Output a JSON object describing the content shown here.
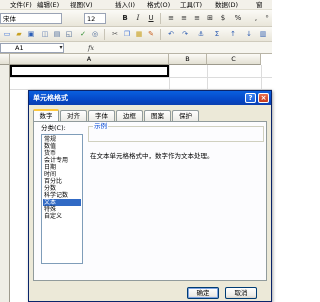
{
  "menubar": {
    "items": [
      "文件(F)",
      "编辑(E)",
      "视图(V)",
      "插入(I)",
      "格式(O)",
      "工具(T)",
      "数据(D)",
      "窗"
    ]
  },
  "toolbar": {
    "font_name": "宋体",
    "font_size": "12",
    "bold": "B",
    "italic": "I",
    "underline": "U",
    "percent": "%",
    "comma": ","
  },
  "formula_bar": {
    "cell_ref": "A1",
    "fx": "fx"
  },
  "sheet": {
    "columns": [
      "A",
      "B",
      "C"
    ]
  },
  "dialog": {
    "title": "单元格格式",
    "help": "?",
    "close": "×",
    "tabs": [
      "数字",
      "对齐",
      "字体",
      "边框",
      "图案",
      "保护"
    ],
    "active_tab": "数字",
    "category_label": "分类(C):",
    "categories": [
      "常规",
      "数值",
      "货币",
      "会计专用",
      "日期",
      "时间",
      "百分比",
      "分数",
      "科学记数",
      "文本",
      "特殊",
      "自定义"
    ],
    "selected_category": "文本",
    "sample_label": "示例",
    "description": "在文本单元格格式中，数字作为文本处理。",
    "ok": "确定",
    "cancel": "取消"
  }
}
